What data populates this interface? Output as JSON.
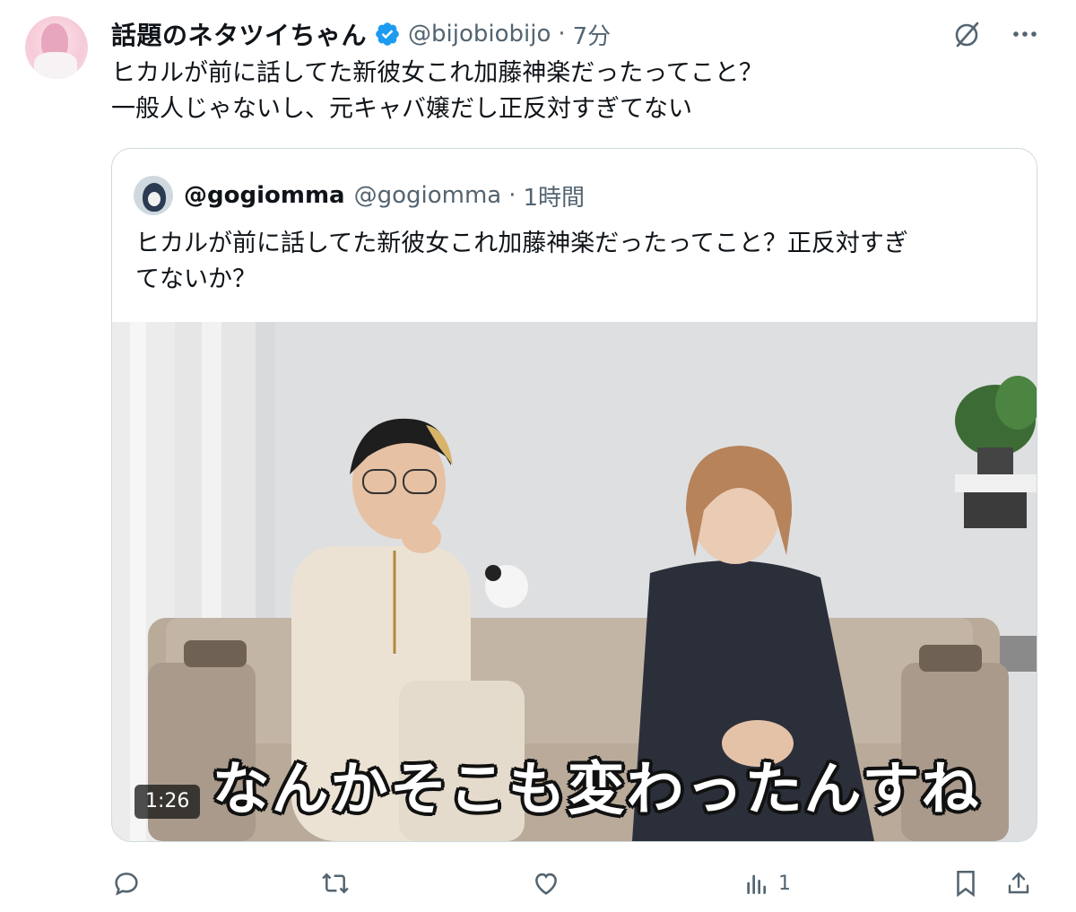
{
  "author": {
    "name": "話題のネタツイちゃん",
    "handle": "@bijobiobijo",
    "separator": "·",
    "time": "7分",
    "verified": true
  },
  "tweet": {
    "lines": [
      "ヒカルが前に話してた新彼女これ加藤神楽だったってこと？",
      "一般人じゃないし、元キャバ嬢だし正反対すぎてない"
    ]
  },
  "quote": {
    "name": "@gogiomma",
    "handle": "@gogiomma",
    "separator": "·",
    "time": "1時間",
    "lines": [
      "ヒカルが前に話してた新彼女これ加藤神楽だったってこと？正反対すぎ",
      "てないか？"
    ],
    "video": {
      "duration": "1:26",
      "subtitle": "なんかそこも変わったんすね"
    }
  },
  "actions": {
    "reply_icon": "reply-icon",
    "retweet_icon": "retweet-icon",
    "like_icon": "like-icon",
    "views_icon": "views-icon",
    "views_count": "1",
    "bookmark_icon": "bookmark-icon",
    "share_icon": "share-icon"
  },
  "colors": {
    "verified_blue": "#1d9bf0",
    "secondary_text": "#536471",
    "border": "#cfd9de"
  }
}
